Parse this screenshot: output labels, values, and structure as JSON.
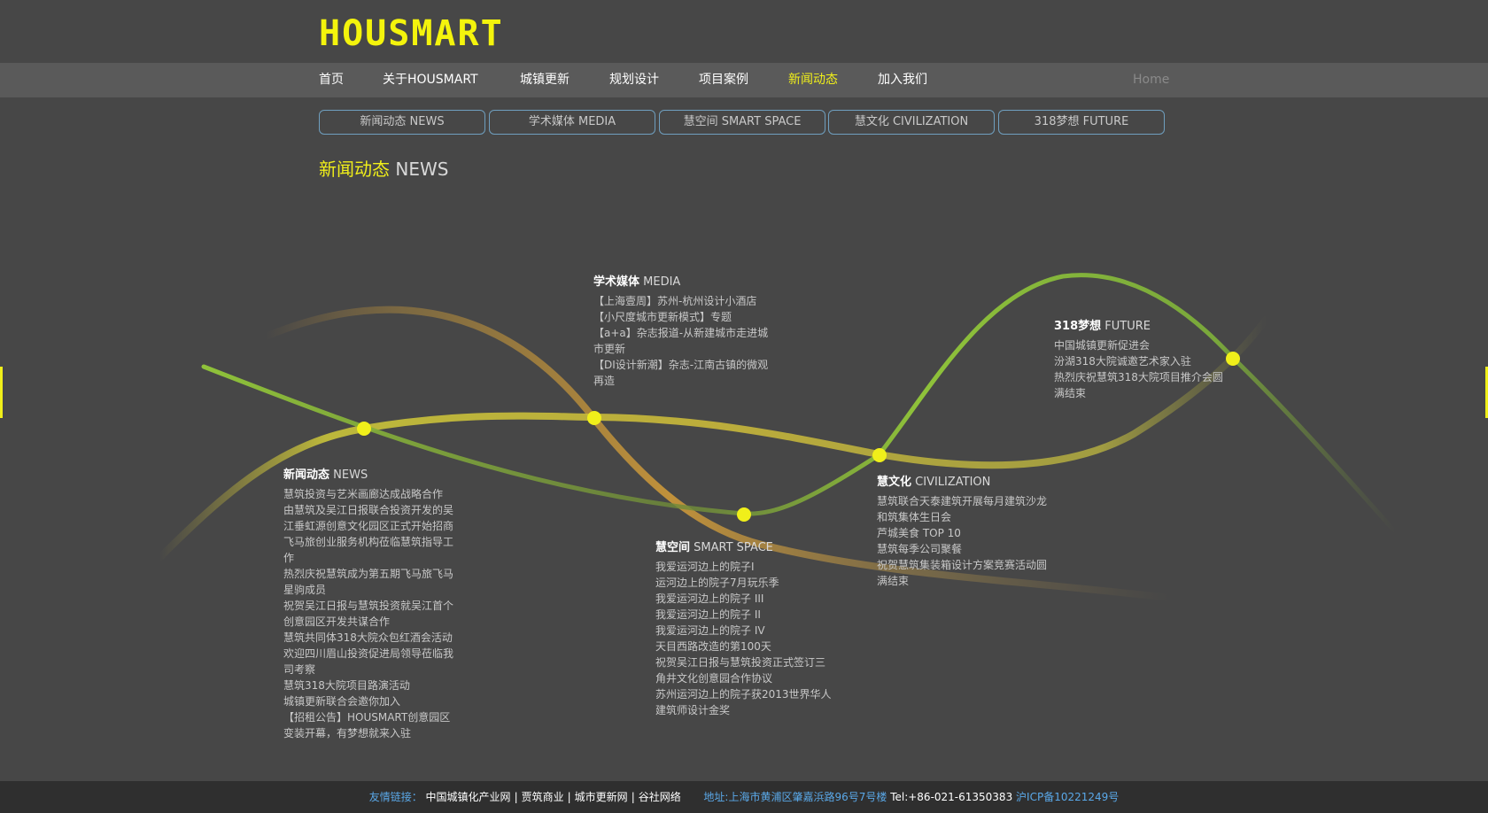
{
  "brand": {
    "logo_text": "HOUSMART"
  },
  "nav": {
    "items": [
      "首页",
      "关于HOUSMART",
      "城镇更新",
      "规划设计",
      "项目案例",
      "新闻动态",
      "加入我们"
    ],
    "active_index": 5,
    "home_link": "Home"
  },
  "subtabs": [
    "新闻动态 NEWS",
    "学术媒体 MEDIA",
    "慧空间 SMART SPACE",
    "慧文化 CIVILIZATION",
    "318梦想 FUTURE"
  ],
  "section_title": {
    "cn": "新闻动态",
    "en": "NEWS"
  },
  "nodes": {
    "news": {
      "title_cn": "新闻动态",
      "title_en": "NEWS",
      "items": [
        "慧筑投资与艺米画廊达成战略合作",
        "由慧筑及吴江日报联合投资开发的吴江垂虹源创意文化园区正式开始招商",
        "飞马旅创业服务机构莅临慧筑指导工作",
        "热烈庆祝慧筑成为第五期飞马旅飞马星驹成员",
        "祝贺吴江日报与慧筑投资就吴江首个创意园区开发共谋合作",
        "慧筑共同体318大院众包红酒会活动",
        "欢迎四川眉山投资促进局领导莅临我司考察",
        "慧筑318大院项目路演活动",
        "城镇更新联合会邀你加入",
        "【招租公告】HOUSMART创意园区变装开幕，有梦想就来入驻"
      ]
    },
    "media": {
      "title_cn": "学术媒体",
      "title_en": "MEDIA",
      "items": [
        "【上海壹周】苏州-杭州设计小酒店",
        "【小尺度城市更新模式】专题",
        "【a+a】杂志报道-从新建城市走进城市更新",
        "【DI设计新潮】杂志-江南古镇的微观再造"
      ]
    },
    "space": {
      "title_cn": "慧空间",
      "title_en": "SMART SPACE",
      "items": [
        "我爱运河边上的院子I",
        "运河边上的院子7月玩乐季",
        "我爱运河边上的院子 III",
        "我爱运河边上的院子 II",
        "我爱运河边上的院子 IV",
        "天目西路改造的第100天",
        "祝贺吴江日报与慧筑投资正式签订三角井文化创意园合作协议",
        "苏州运河边上的院子获2013世界华人建筑师设计金奖"
      ]
    },
    "civilization": {
      "title_cn": "慧文化",
      "title_en": "CIVILIZATION",
      "items": [
        "慧筑联合天泰建筑开展每月建筑沙龙",
        "和筑集体生日会",
        "芦城美食 TOP 10",
        "慧筑每季公司聚餐",
        "祝贺慧筑集装箱设计方案竞赛活动圆满结束"
      ]
    },
    "future": {
      "title_cn": "318梦想",
      "title_en": "FUTURE",
      "items": [
        "中国城镇更新促进会",
        "汾湖318大院诚邀艺术家入驻",
        "热烈庆祝慧筑318大院项目推介会圆满结束"
      ]
    }
  },
  "footer": {
    "links_label": "友情链接：",
    "links": [
      "中国城镇化产业网",
      "贾筑商业",
      "城市更新网",
      "谷社网络"
    ],
    "address": "地址:上海市黄浦区肇嘉浜路96号7号楼",
    "tel": "Tel:+86-021-61350383",
    "icp": "沪ICP备10221249号"
  },
  "colors": {
    "background": "#474747",
    "nav_bar": "#5a5a5a",
    "accent_yellow": "#f0ef1a",
    "footer_bg": "#2f2f2f",
    "link_blue": "#5aa8e8",
    "curve_green": "#8fc23a",
    "curve_gold": "#c9b83a",
    "curve_orange": "#c7953a"
  }
}
